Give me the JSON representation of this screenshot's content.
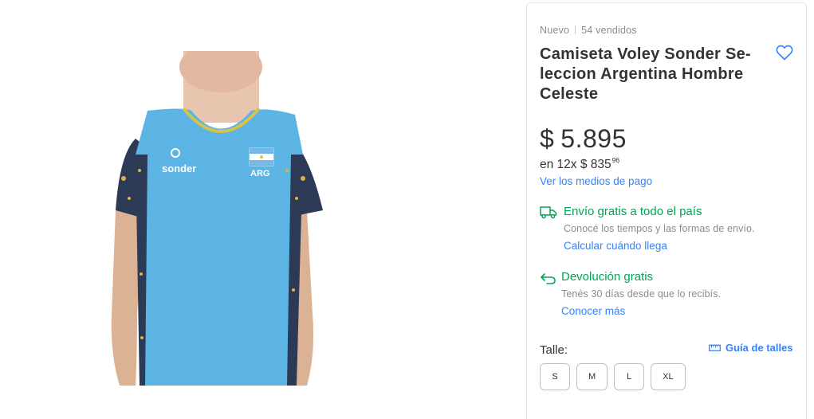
{
  "product": {
    "condition": "Nuevo",
    "sold": "54 vendidos",
    "title": "Camiseta Voley Sonder Se-leccion Argentina Hombre Celeste",
    "currency": "$",
    "price": "5.895",
    "installments_prefix": "en 12x $ 835",
    "installments_cents": "96",
    "payment_link": "Ver los medios de pago"
  },
  "shipping": {
    "title": "Envío gratis a todo el país",
    "desc": "Conocé los tiempos y las formas de envío.",
    "link": "Calcular cuándo llega"
  },
  "returns": {
    "title": "Devolución gratis",
    "desc": "Tenés 30 días desde que lo recibís.",
    "link": "Conocer más"
  },
  "sizes": {
    "label": "Talle:",
    "guide": "Guía de talles",
    "options": [
      "S",
      "M",
      "L",
      "XL"
    ]
  },
  "image": {
    "brand_text": "sonder",
    "flag_text": "ARG"
  },
  "colors": {
    "accent": "#3483fa",
    "green": "#00a650",
    "shirt": "#5bb4e3"
  }
}
